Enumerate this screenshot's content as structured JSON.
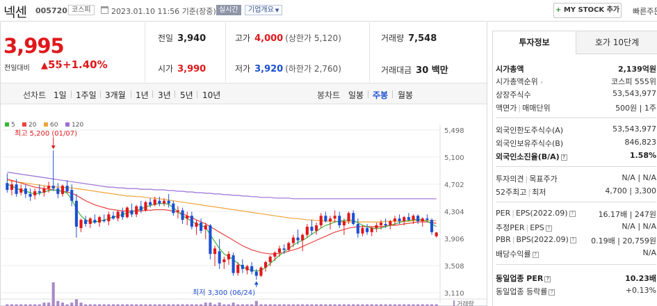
{
  "header": {
    "name": "넥센",
    "code": "005720",
    "market": "코스피",
    "as_of": "2023.01.10 11:56 기준(장중)",
    "realtime_label": "실시간",
    "company_overview": "기업개요",
    "mystock_label": "MY STOCK 추가",
    "quick_label": "빠른주문"
  },
  "quote": {
    "price": "3,995",
    "change_label": "전일대비",
    "change": "55",
    "change_pct": "+1.40%",
    "prev_close_label": "전일",
    "prev_close": "3,940",
    "high_label": "고가",
    "high": "4,000",
    "upper_limit": "(상한가 5,120)",
    "volume_label": "거래량",
    "volume": "7,548",
    "open_label": "시가",
    "open": "3,990",
    "low_label": "저가",
    "low": "3,920",
    "lower_limit": "(하한가 2,760)",
    "value_label": "거래대금",
    "value": "30 백만"
  },
  "toolbar": {
    "line_chart_label": "선차트",
    "periods": [
      "1일",
      "1주일",
      "3개월",
      "1년",
      "3년",
      "5년",
      "10년"
    ],
    "candle_label": "봉차트",
    "candle_periods": [
      "일봉",
      "주봉",
      "월봉"
    ],
    "active_candle": "주봉"
  },
  "tabs": [
    "투자정보",
    "호가 10단계"
  ],
  "info": {
    "market_cap_label": "시가총액",
    "market_cap": "2,139억원",
    "market_cap_rank_label": "시가총액순위",
    "market_cap_rank": "코스피 555위",
    "listed_shares_label": "상장주식수",
    "listed_shares": "53,543,977",
    "par_label": "액면가",
    "unit_label": "매매단위",
    "par_unit": "500원 | 1주",
    "foreign_limit_label": "외국인한도주식수(A)",
    "foreign_limit": "53,543,977",
    "foreign_hold_label": "외국인보유주식수(B)",
    "foreign_hold": "846,823",
    "foreign_ratio_label": "외국인소진율(B/A)",
    "foreign_ratio": "1.58%",
    "opinion_label": "투자의견",
    "target_label": "목표주가",
    "opinion_target": "N/A | N/A",
    "week52_label": "52주최고",
    "week52_low_label": "최저",
    "week52": "4,700 | 3,300",
    "per_label": "PER",
    "eps_label": "EPS(2022.09)",
    "per_eps": "16.17배 | 247원",
    "est_per_label": "추정PER",
    "est_eps_label": "EPS",
    "est_per_eps": "N/A | N/A",
    "pbr_label": "PBR",
    "bps_label": "BPS(2022.09)",
    "pbr_bps": "0.19배 | 20,759원",
    "dividend_label": "배당수익률",
    "dividend": "N/A",
    "sector_per_label": "동일업종 PER",
    "sector_per": "10.23배",
    "sector_chg_label": "동일업종 등락률",
    "sector_chg": "+0.13%"
  },
  "chart_data": {
    "type": "candlestick",
    "ma_legend": [
      {
        "name": "5",
        "color": "#3cb63c"
      },
      {
        "name": "20",
        "color": "#e8423f"
      },
      {
        "name": "60",
        "color": "#f0a43a"
      },
      {
        "name": "120",
        "color": "#9a6fd6"
      }
    ],
    "y_ticks": [
      "5,498",
      "5,100",
      "4,702",
      "4,304",
      "3,906",
      "3,508",
      "3,110"
    ],
    "ylim": [
      3110,
      5498
    ],
    "annotations": [
      {
        "text": "최고 5,200 (01/07)",
        "index": 10,
        "value": 5200
      },
      {
        "text": "최저 3,300 (06/24)",
        "index": 54,
        "value": 3300
      }
    ],
    "volume_label": "거래량",
    "candles": [
      [
        4720,
        4860,
        4580,
        4620
      ],
      [
        4620,
        4760,
        4540,
        4700
      ],
      [
        4700,
        4780,
        4520,
        4560
      ],
      [
        4580,
        4700,
        4540,
        4640
      ],
      [
        4640,
        4700,
        4500,
        4560
      ],
      [
        4560,
        4640,
        4460,
        4520
      ],
      [
        4540,
        4640,
        4480,
        4600
      ],
      [
        4600,
        4700,
        4540,
        4580
      ],
      [
        4580,
        4680,
        4520,
        4640
      ],
      [
        4640,
        4740,
        4580,
        4680
      ],
      [
        4680,
        5200,
        4600,
        4640
      ],
      [
        4640,
        4720,
        4500,
        4560
      ],
      [
        4560,
        4700,
        4520,
        4680
      ],
      [
        4680,
        4760,
        4580,
        4600
      ],
      [
        4620,
        4700,
        4380,
        4460
      ],
      [
        4460,
        4560,
        3920,
        4080
      ],
      [
        4060,
        4200,
        4000,
        4180
      ],
      [
        4180,
        4240,
        4080,
        4120
      ],
      [
        4120,
        4220,
        4060,
        4200
      ],
      [
        4180,
        4260,
        4120,
        4140
      ],
      [
        4140,
        4240,
        4080,
        4220
      ],
      [
        4180,
        4260,
        4140,
        4160
      ],
      [
        4160,
        4300,
        4100,
        4260
      ],
      [
        4240,
        4300,
        4180,
        4200
      ],
      [
        4200,
        4320,
        4160,
        4300
      ],
      [
        4300,
        4360,
        4180,
        4220
      ],
      [
        4220,
        4380,
        4200,
        4360
      ],
      [
        4320,
        4420,
        4220,
        4260
      ],
      [
        4260,
        4400,
        4220,
        4380
      ],
      [
        4380,
        4460,
        4280,
        4320
      ],
      [
        4320,
        4460,
        4300,
        4440
      ],
      [
        4440,
        4500,
        4360,
        4400
      ],
      [
        4400,
        4520,
        4380,
        4480
      ],
      [
        4460,
        4520,
        4380,
        4420
      ],
      [
        4420,
        4500,
        4380,
        4460
      ],
      [
        4460,
        4560,
        4360,
        4420
      ],
      [
        4420,
        4460,
        4240,
        4280
      ],
      [
        4300,
        4380,
        4200,
        4320
      ],
      [
        4320,
        4360,
        4120,
        4180
      ],
      [
        4200,
        4300,
        4100,
        4240
      ],
      [
        4240,
        4300,
        4040,
        4080
      ],
      [
        4080,
        4180,
        3960,
        4140
      ],
      [
        4140,
        4200,
        3980,
        4020
      ],
      [
        4040,
        4140,
        3900,
        4100
      ],
      [
        4100,
        4120,
        3600,
        3680
      ],
      [
        3680,
        3800,
        3500,
        3760
      ],
      [
        3720,
        3900,
        3460,
        3540
      ],
      [
        3560,
        3640,
        3460,
        3600
      ],
      [
        3600,
        3720,
        3520,
        3680
      ],
      [
        3660,
        3700,
        3360,
        3400
      ],
      [
        3400,
        3560,
        3360,
        3520
      ],
      [
        3520,
        3600,
        3400,
        3460
      ],
      [
        3440,
        3520,
        3380,
        3500
      ],
      [
        3500,
        3560,
        3380,
        3420
      ],
      [
        3420,
        3460,
        3300,
        3360
      ],
      [
        3360,
        3500,
        3340,
        3480
      ],
      [
        3480,
        3580,
        3420,
        3560
      ],
      [
        3560,
        3660,
        3500,
        3640
      ],
      [
        3640,
        3720,
        3580,
        3700
      ],
      [
        3700,
        3800,
        3640,
        3760
      ],
      [
        3760,
        3820,
        3680,
        3740
      ],
      [
        3740,
        3860,
        3720,
        3840
      ],
      [
        3840,
        3960,
        3780,
        3920
      ],
      [
        3920,
        4040,
        3820,
        3880
      ],
      [
        3880,
        3980,
        3720,
        3960
      ],
      [
        3960,
        4120,
        3920,
        4080
      ],
      [
        4080,
        4180,
        3960,
        4020
      ],
      [
        4020,
        4140,
        3960,
        4100
      ],
      [
        4100,
        4280,
        4060,
        4240
      ],
      [
        4240,
        4300,
        4140,
        4160
      ],
      [
        4160,
        4240,
        4040,
        4200
      ],
      [
        4200,
        4320,
        4140,
        4240
      ],
      [
        4240,
        4300,
        4060,
        4100
      ],
      [
        4100,
        4200,
        3960,
        4160
      ],
      [
        4160,
        4300,
        4120,
        4280
      ],
      [
        4280,
        4320,
        4100,
        4120
      ],
      [
        4120,
        4200,
        3920,
        3980
      ],
      [
        3980,
        4100,
        3940,
        4060
      ],
      [
        4060,
        4120,
        3960,
        4000
      ],
      [
        4000,
        4080,
        3940,
        4060
      ],
      [
        4060,
        4140,
        4000,
        4100
      ],
      [
        4100,
        4180,
        4040,
        4140
      ],
      [
        4120,
        4200,
        4060,
        4100
      ],
      [
        4100,
        4180,
        4040,
        4160
      ],
      [
        4160,
        4240,
        4100,
        4200
      ],
      [
        4200,
        4260,
        4120,
        4160
      ],
      [
        4160,
        4240,
        4100,
        4220
      ],
      [
        4220,
        4280,
        4160,
        4180
      ],
      [
        4180,
        4260,
        4120,
        4240
      ],
      [
        4240,
        4260,
        4120,
        4160
      ],
      [
        4160,
        4220,
        4080,
        4200
      ],
      [
        4200,
        4260,
        4160,
        4180
      ],
      [
        4180,
        4200,
        3960,
        4000
      ],
      [
        3940,
        4000,
        3920,
        3995
      ]
    ],
    "ma5": [
      4700,
      4680,
      4640,
      4620,
      4600,
      4580,
      4560,
      4570,
      4590,
      4610,
      4620,
      4610,
      4600,
      4570,
      4480,
      4340,
      4240,
      4180,
      4150,
      4150,
      4160,
      4180,
      4200,
      4220,
      4240,
      4260,
      4280,
      4300,
      4320,
      4340,
      4370,
      4390,
      4410,
      4420,
      4420,
      4410,
      4360,
      4300,
      4240,
      4200,
      4160,
      4120,
      4100,
      4070,
      3960,
      3860,
      3760,
      3680,
      3640,
      3600,
      3540,
      3490,
      3460,
      3440,
      3430,
      3440,
      3480,
      3540,
      3600,
      3660,
      3710,
      3760,
      3810,
      3850,
      3880,
      3920,
      3970,
      4010,
      4060,
      4100,
      4120,
      4150,
      4160,
      4170,
      4180,
      4170,
      4140,
      4100,
      4080,
      4060,
      4050,
      4060,
      4080,
      4100,
      4120,
      4140,
      4160,
      4170,
      4180,
      4190,
      4180,
      4160,
      4120,
      4080
    ],
    "ma20": [
      4780,
      4760,
      4740,
      4720,
      4700,
      4680,
      4660,
      4650,
      4640,
      4630,
      4620,
      4610,
      4600,
      4590,
      4570,
      4540,
      4500,
      4460,
      4430,
      4400,
      4380,
      4360,
      4340,
      4330,
      4320,
      4310,
      4310,
      4310,
      4310,
      4310,
      4320,
      4320,
      4330,
      4330,
      4330,
      4320,
      4310,
      4290,
      4270,
      4240,
      4210,
      4180,
      4150,
      4120,
      4080,
      4040,
      4000,
      3960,
      3920,
      3880,
      3840,
      3800,
      3770,
      3740,
      3720,
      3700,
      3690,
      3680,
      3680,
      3690,
      3700,
      3720,
      3740,
      3760,
      3790,
      3820,
      3850,
      3880,
      3910,
      3940,
      3970,
      4000,
      4020,
      4040,
      4060,
      4070,
      4080,
      4080,
      4080,
      4080,
      4080,
      4080,
      4090,
      4100,
      4100,
      4110,
      4120,
      4130,
      4140,
      4150,
      4150,
      4150,
      4140,
      4130
    ],
    "ma60": [
      4760,
      4750,
      4740,
      4730,
      4720,
      4710,
      4700,
      4690,
      4680,
      4670,
      4670,
      4660,
      4660,
      4650,
      4650,
      4640,
      4630,
      4620,
      4610,
      4600,
      4590,
      4580,
      4570,
      4560,
      4550,
      4540,
      4530,
      4530,
      4520,
      4520,
      4510,
      4500,
      4500,
      4490,
      4480,
      4470,
      4460,
      4450,
      4440,
      4430,
      4420,
      4410,
      4400,
      4390,
      4380,
      4370,
      4360,
      4350,
      4340,
      4330,
      4320,
      4310,
      4300,
      4290,
      4280,
      4270,
      4260,
      4250,
      4240,
      4230,
      4220,
      4210,
      4200,
      4200,
      4190,
      4180,
      4180,
      4170,
      4170,
      4160,
      4160,
      4160,
      4150,
      4150,
      4150,
      4150,
      4150,
      4150,
      4150,
      4150,
      4150,
      4150,
      4160,
      4160,
      4160,
      4160,
      4160,
      4160,
      4170,
      4170,
      4170,
      4170,
      4170,
      4170
    ],
    "ma120": [
      4880,
      4870,
      4860,
      4850,
      4840,
      4830,
      4820,
      4810,
      4800,
      4790,
      4780,
      4770,
      4760,
      4750,
      4740,
      4730,
      4720,
      4710,
      4700,
      4690,
      4680,
      4670,
      4660,
      4660,
      4650,
      4650,
      4640,
      4640,
      4640,
      4630,
      4630,
      4630,
      4620,
      4620,
      4620,
      4610,
      4610,
      4600,
      4600,
      4590,
      4590,
      4580,
      4580,
      4570,
      4570,
      4560,
      4560,
      4550,
      4550,
      4540,
      4540,
      4530,
      4530,
      4520,
      4520,
      4510,
      4510,
      4510,
      4500,
      4500,
      4500,
      4500,
      4490,
      4490,
      4490,
      4490,
      4490,
      4490,
      4490,
      4490,
      4490,
      4490,
      4490,
      4490,
      4490,
      4490,
      4490,
      4490,
      4490,
      4490,
      4490,
      4490,
      4490,
      4490,
      4490,
      4490,
      4490,
      4490,
      4490,
      4490,
      4490,
      4490,
      4490,
      4490
    ],
    "volume": [
      1,
      1,
      1,
      1,
      1,
      1,
      1,
      1,
      2,
      2,
      14,
      3,
      2,
      1,
      2,
      4,
      2,
      1,
      1,
      1,
      1,
      1,
      1,
      1,
      1,
      1,
      1,
      1,
      1,
      1,
      1,
      1,
      1,
      1,
      1,
      1,
      1,
      1,
      1,
      1,
      1,
      1,
      1,
      2,
      2,
      1,
      2,
      1,
      1,
      2,
      1,
      1,
      1,
      1,
      3,
      1,
      1,
      1,
      1,
      1,
      1,
      1,
      1,
      1,
      1,
      1,
      1,
      1,
      1,
      1,
      1,
      1,
      1,
      1,
      1,
      1,
      1,
      1,
      1,
      1,
      1,
      1,
      1,
      1,
      1,
      1,
      1,
      1,
      1,
      1,
      1,
      1,
      1,
      1
    ]
  }
}
